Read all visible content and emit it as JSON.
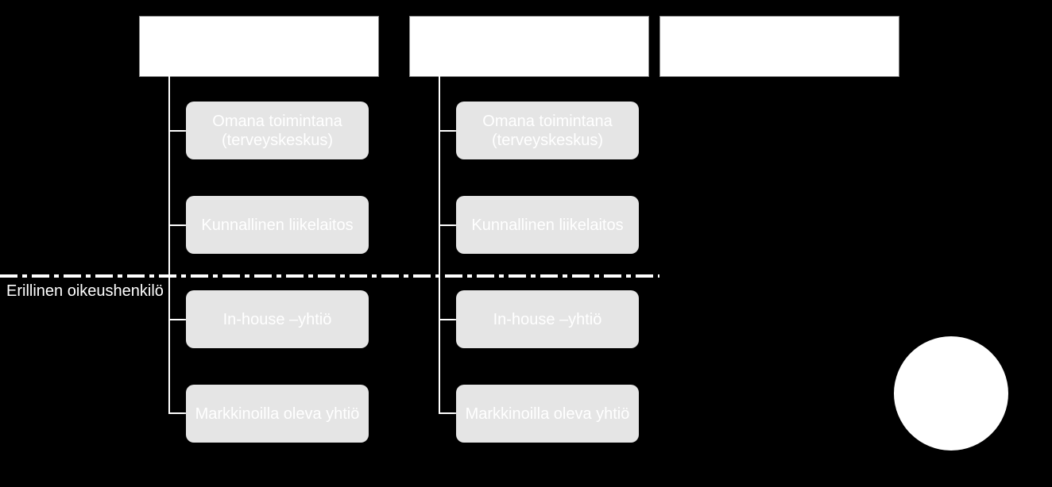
{
  "diagram": {
    "columns": [
      {
        "header": "",
        "items": [
          {
            "label": "Omana toimintana (terveyskeskus)"
          },
          {
            "label": "Kunnallinen liikelaitos"
          },
          {
            "label": "In-house –yhtiö"
          },
          {
            "label": "Markkinoilla oleva yhtiö"
          }
        ]
      },
      {
        "header": "",
        "items": [
          {
            "label": "Omana toimintana (terveyskeskus)"
          },
          {
            "label": "Kunnallinen liikelaitos"
          },
          {
            "label": "In-house –yhtiö"
          },
          {
            "label": "Markkinoilla oleva yhtiö"
          }
        ]
      },
      {
        "header": "",
        "items": []
      }
    ],
    "separator_label": "Erillinen oikeushenkilö"
  }
}
